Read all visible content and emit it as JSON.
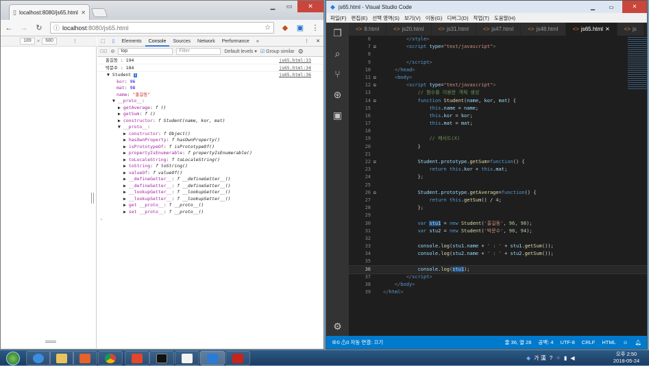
{
  "chrome": {
    "tab_title": "localhost:8080/js65.html",
    "url_host": "localhost",
    "url_path": ":8080/js65.html",
    "device_width": "189",
    "device_height": "680",
    "devtools_tabs": [
      "Elements",
      "Console",
      "Sources",
      "Network",
      "Performance",
      "»"
    ],
    "context": "top",
    "filter_placeholder": "Filter",
    "levels": "Default levels ▾",
    "group_similar": "Group similar"
  },
  "console": {
    "logs": [
      {
        "text": "홍길동 : 194",
        "src": "js65.html:33"
      },
      {
        "text": "박문수 : 184",
        "src": "js65.html:34"
      }
    ],
    "object_src": "js65.html:36",
    "object_name": "Student",
    "kor": "96",
    "mat": "98",
    "name_val": "\"홍길동\"",
    "proto_label": "__proto__",
    "getAverage": "f ()",
    "getSum": "f ()",
    "constructor1": "f Student(name, kor, mat)",
    "inner_proto_items": [
      {
        "key": "constructor",
        "val": "f Object()"
      },
      {
        "key": "hasOwnProperty",
        "val": "f hasOwnProperty()"
      },
      {
        "key": "isPrototypeOf",
        "val": "f isPrototypeOf()"
      },
      {
        "key": "propertyIsEnumerable",
        "val": "f propertyIsEnumerable()"
      },
      {
        "key": "toLocaleString",
        "val": "f toLocaleString()"
      },
      {
        "key": "toString",
        "val": "f toString()"
      },
      {
        "key": "valueOf",
        "val": "f valueOf()"
      },
      {
        "key": "__defineGetter__",
        "val": "f __defineGetter__()"
      },
      {
        "key": "__defineSetter__",
        "val": "f __defineSetter__()"
      },
      {
        "key": "__lookupGetter__",
        "val": "f __lookupGetter__()"
      },
      {
        "key": "__lookupSetter__",
        "val": "f __lookupSetter__()"
      },
      {
        "key": "get __proto__",
        "val": "f __proto__()"
      },
      {
        "key": "set __proto__",
        "val": "f __proto__()"
      }
    ]
  },
  "vscode": {
    "title": "js65.html - Visual Studio Code",
    "menu": [
      "파일(F)",
      "편집(E)",
      "선택 영역(S)",
      "보기(V)",
      "이동(G)",
      "디버그(D)",
      "작업(T)",
      "도움말(H)"
    ],
    "tabs": [
      {
        "label": "8.html",
        "active": false
      },
      {
        "label": "js20.html",
        "active": false
      },
      {
        "label": "js31.html",
        "active": false
      },
      {
        "label": "js47.html",
        "active": false
      },
      {
        "label": "js48.html",
        "active": false
      },
      {
        "label": "js65.html",
        "active": true
      },
      {
        "label": "js",
        "active": false
      }
    ],
    "status_left": "⊗0 ⚠0   자동 연결: 끄기",
    "status_pos": "줄 36, 열 28",
    "status_indent": "공백: 4",
    "status_enc": "UTF-8",
    "status_eol": "CRLF",
    "status_lang": "HTML"
  },
  "taskbar": {
    "lang": "가 漢",
    "time": "오후 2:50",
    "date": "2018-05-24"
  }
}
